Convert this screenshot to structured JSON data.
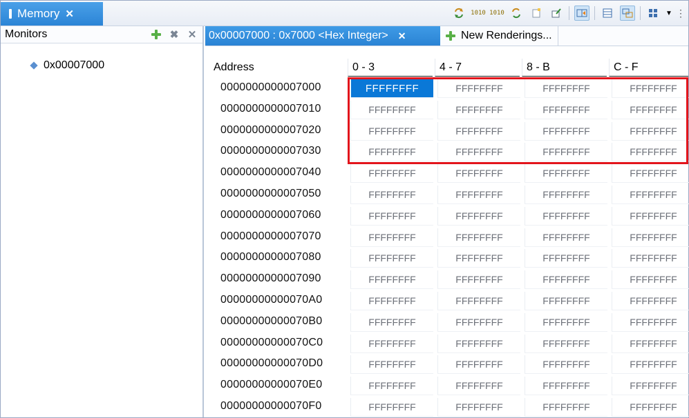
{
  "view": {
    "title": "Memory",
    "close": "✕"
  },
  "toolbar": {
    "icons": [
      "sync-icon",
      "bits-icon",
      "bits-icon",
      "sync-icon",
      "new-tab-icon",
      "export-icon",
      "toggle-split-icon",
      "table-icon",
      "link-icon",
      "columns-icon",
      "dropdown-icon",
      "more-icon"
    ],
    "bits_label": "1010"
  },
  "monitors": {
    "title": "Monitors",
    "items": [
      {
        "label": "0x00007000"
      }
    ]
  },
  "rendering": {
    "active_tab": "0x00007000 : 0x7000 <Hex Integer>",
    "new_tab": "New Renderings...",
    "close": "✕",
    "columns": [
      "Address",
      "0 - 3",
      "4 - 7",
      "8 - B",
      "C - F"
    ],
    "rows": [
      {
        "address": "0000000000007000",
        "values": [
          "FFFFFFFF",
          "FFFFFFFF",
          "FFFFFFFF",
          "FFFFFFFF"
        ]
      },
      {
        "address": "0000000000007010",
        "values": [
          "FFFFFFFF",
          "FFFFFFFF",
          "FFFFFFFF",
          "FFFFFFFF"
        ]
      },
      {
        "address": "0000000000007020",
        "values": [
          "FFFFFFFF",
          "FFFFFFFF",
          "FFFFFFFF",
          "FFFFFFFF"
        ]
      },
      {
        "address": "0000000000007030",
        "values": [
          "FFFFFFFF",
          "FFFFFFFF",
          "FFFFFFFF",
          "FFFFFFFF"
        ]
      },
      {
        "address": "0000000000007040",
        "values": [
          "FFFFFFFF",
          "FFFFFFFF",
          "FFFFFFFF",
          "FFFFFFFF"
        ]
      },
      {
        "address": "0000000000007050",
        "values": [
          "FFFFFFFF",
          "FFFFFFFF",
          "FFFFFFFF",
          "FFFFFFFF"
        ]
      },
      {
        "address": "0000000000007060",
        "values": [
          "FFFFFFFF",
          "FFFFFFFF",
          "FFFFFFFF",
          "FFFFFFFF"
        ]
      },
      {
        "address": "0000000000007070",
        "values": [
          "FFFFFFFF",
          "FFFFFFFF",
          "FFFFFFFF",
          "FFFFFFFF"
        ]
      },
      {
        "address": "0000000000007080",
        "values": [
          "FFFFFFFF",
          "FFFFFFFF",
          "FFFFFFFF",
          "FFFFFFFF"
        ]
      },
      {
        "address": "0000000000007090",
        "values": [
          "FFFFFFFF",
          "FFFFFFFF",
          "FFFFFFFF",
          "FFFFFFFF"
        ]
      },
      {
        "address": "00000000000070A0",
        "values": [
          "FFFFFFFF",
          "FFFFFFFF",
          "FFFFFFFF",
          "FFFFFFFF"
        ]
      },
      {
        "address": "00000000000070B0",
        "values": [
          "FFFFFFFF",
          "FFFFFFFF",
          "FFFFFFFF",
          "FFFFFFFF"
        ]
      },
      {
        "address": "00000000000070C0",
        "values": [
          "FFFFFFFF",
          "FFFFFFFF",
          "FFFFFFFF",
          "FFFFFFFF"
        ]
      },
      {
        "address": "00000000000070D0",
        "values": [
          "FFFFFFFF",
          "FFFFFFFF",
          "FFFFFFFF",
          "FFFFFFFF"
        ]
      },
      {
        "address": "00000000000070E0",
        "values": [
          "FFFFFFFF",
          "FFFFFFFF",
          "FFFFFFFF",
          "FFFFFFFF"
        ]
      },
      {
        "address": "00000000000070F0",
        "values": [
          "FFFFFFFF",
          "FFFFFFFF",
          "FFFFFFFF",
          "FFFFFFFF"
        ]
      }
    ]
  },
  "colors": {
    "accent": "#2b84d6",
    "highlight": "#e2141b",
    "selection": "#0a78d7"
  }
}
